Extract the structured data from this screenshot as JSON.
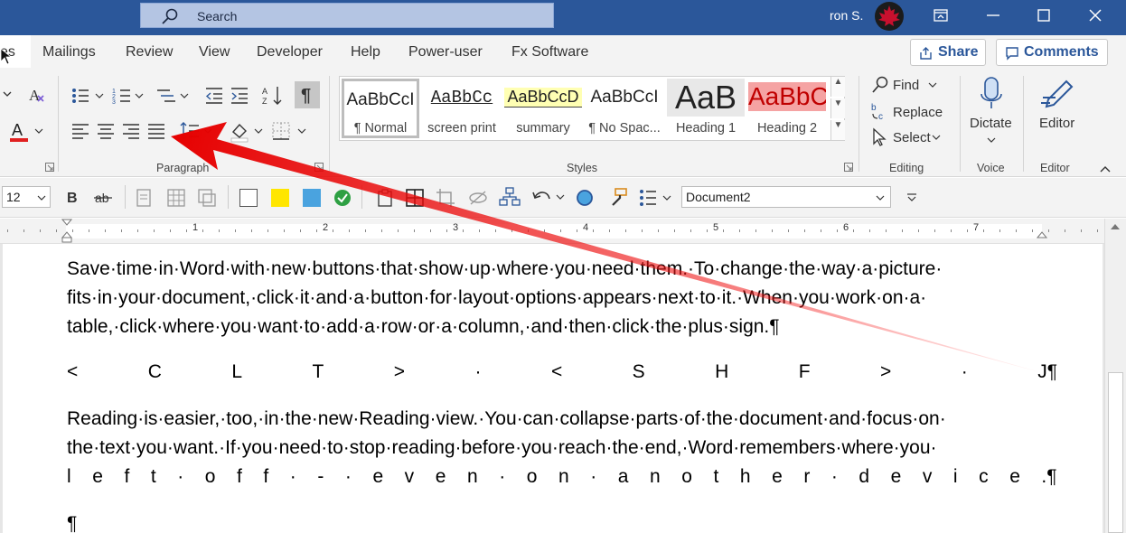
{
  "titlebar": {
    "search_placeholder": "Search",
    "user_name": "ron S."
  },
  "tabs": [
    "es",
    "Mailings",
    "Review",
    "View",
    "Developer",
    "Help",
    "Power-user",
    "Fx Software"
  ],
  "header_buttons": {
    "share": "Share",
    "comments": "Comments"
  },
  "ribbon": {
    "groups": {
      "paragraph": "Paragraph",
      "styles": "Styles",
      "editing": "Editing",
      "voice": "Voice",
      "editor": "Editor"
    },
    "styles": [
      {
        "sample": "AaBbCcI",
        "name": "¶ Normal"
      },
      {
        "sample": "AaBbCc",
        "name": "screen print"
      },
      {
        "sample": "AaBbCcD",
        "name": "summary"
      },
      {
        "sample": "AaBbCcI",
        "name": "¶ No Spac..."
      },
      {
        "sample": "AaB",
        "name": "Heading 1"
      },
      {
        "sample": "AaBbC",
        "name": "Heading 2"
      }
    ],
    "editing": {
      "find": "Find",
      "replace": "Replace",
      "select": "Select"
    },
    "voice": {
      "dictate": "Dictate"
    },
    "editor": {
      "editor": "Editor"
    },
    "colors": {
      "font_color": "#e02020",
      "highlight": "#ffe600",
      "accent": "#2b579a"
    }
  },
  "qat": {
    "font_size": "12",
    "document": "Document2"
  },
  "ruler": {
    "numbers": [
      "1",
      "2",
      "3",
      "4",
      "5",
      "6",
      "7"
    ]
  },
  "document": {
    "para1": [
      "Save·time·in·Word·with·new·buttons·that·show·up·where·you·need·them.·To·change·the·way·a·picture·",
      "fits·in·your·document,·click·it·and·a·button·for·layout·options·appears·next·to·it.·When·you·work·on·a·",
      "table,·click·where·you·want·to·add·a·row·or·a·column,·and·then·click·the·plus·sign.¶"
    ],
    "spread_line": [
      "<",
      "C",
      "L",
      "T",
      ">",
      "·",
      "<",
      "S",
      "H",
      "F",
      ">",
      "·",
      "J¶"
    ],
    "para2": [
      "Reading·is·easier,·too,·in·the·new·Reading·view.·You·can·collapse·parts·of·the·document·and·focus·on·",
      "the·text·you·want.·If·you·need·to·stop·reading·before·you·reach·the·end,·Word·remembers·where·you·"
    ],
    "spread_line2": [
      "l",
      "e",
      "f",
      "t",
      "·",
      "o",
      "f",
      "f",
      "·",
      "-",
      "·",
      "e",
      "v",
      "e",
      "n",
      "·",
      "o",
      "n",
      "·",
      "a",
      "n",
      "o",
      "t",
      "h",
      "e",
      "r",
      "·",
      "d",
      "e",
      "v",
      "i",
      "c",
      "e",
      ".¶"
    ],
    "empty_para": "¶"
  }
}
